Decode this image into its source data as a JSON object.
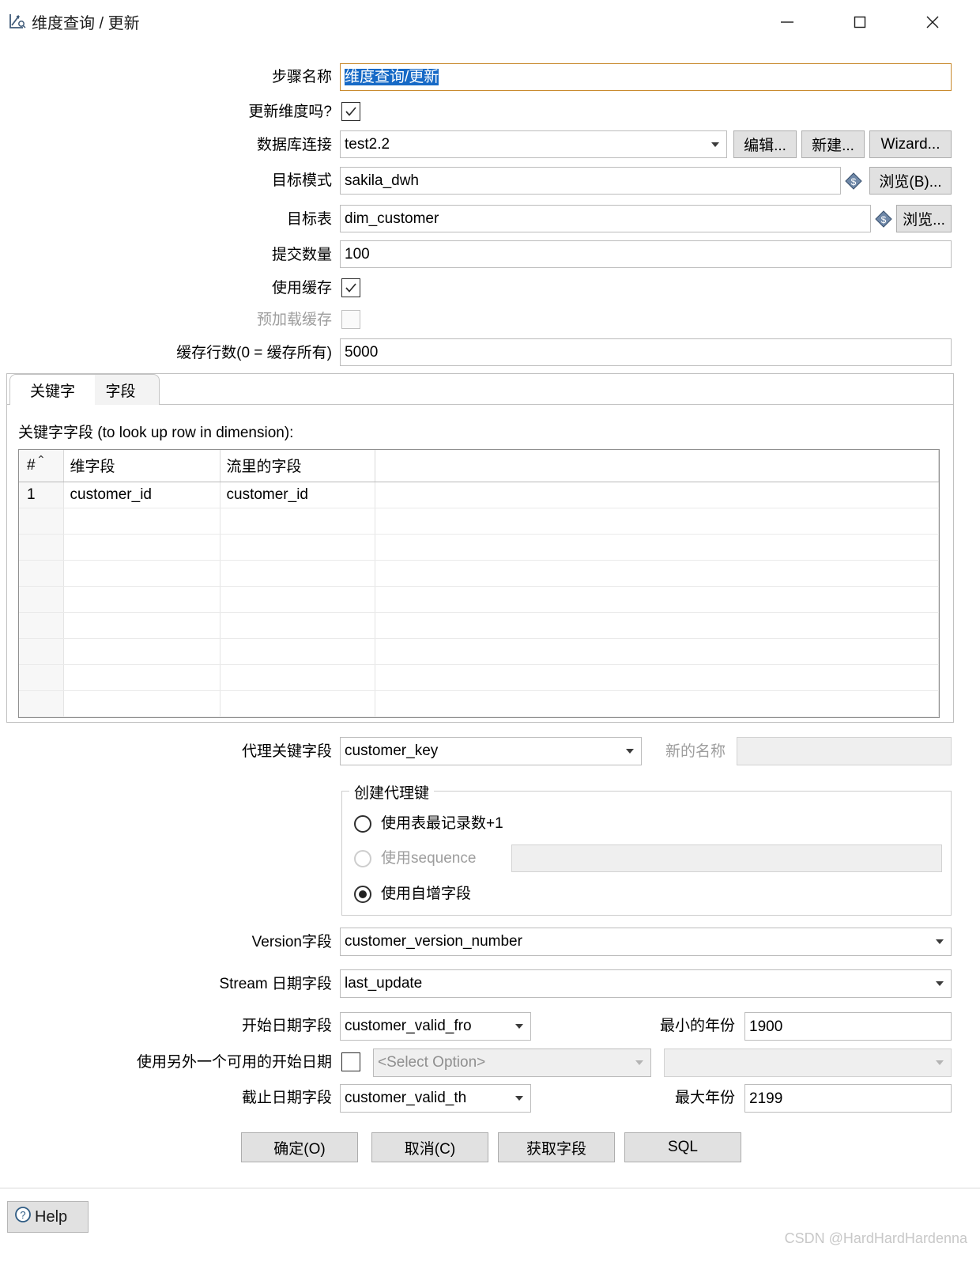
{
  "window": {
    "title": "维度查询 / 更新",
    "icon": "dimension-lookup-icon",
    "minimize_label": "—",
    "maximize_label": "□",
    "close_label": "✕"
  },
  "form": {
    "step_name": {
      "label": "步骤名称",
      "value": "维度查询/更新"
    },
    "update_dimension": {
      "label": "更新维度吗?",
      "checked": true
    },
    "connection": {
      "label": "数据库连接",
      "value": "test2.2"
    },
    "connection_buttons": {
      "edit": "编辑...",
      "new": "新建...",
      "wizard": "Wizard..."
    },
    "target_schema": {
      "label": "目标模式",
      "value": "sakila_dwh",
      "browse": "浏览(B)..."
    },
    "target_table": {
      "label": "目标表",
      "value": "dim_customer",
      "browse": "浏览..."
    },
    "commit_size": {
      "label": "提交数量",
      "value": "100"
    },
    "use_cache": {
      "label": "使用缓存",
      "checked": true
    },
    "preload_cache": {
      "label": "预加载缓存",
      "checked": false,
      "disabled": true
    },
    "cache_rows": {
      "label": "缓存行数(0 = 缓存所有)",
      "value": "5000"
    }
  },
  "tabs": {
    "items": [
      {
        "label": "关键字",
        "selected": true
      },
      {
        "label": "字段",
        "selected": false
      }
    ],
    "caption": "关键字字段 (to look up row in dimension):",
    "grid": {
      "columns": [
        "#",
        "维字段",
        "流里的字段",
        ""
      ],
      "sort_indicator": "⌃",
      "rows": [
        {
          "num": "1",
          "dim_field": "customer_id",
          "stream_field": "customer_id",
          "extra": ""
        }
      ],
      "empty_row_count": 9
    }
  },
  "surrogate": {
    "field_label": "代理关键字段",
    "field_value": "customer_key",
    "new_name_label": "新的名称",
    "new_name_value": "",
    "group_title": "创建代理键",
    "options": [
      {
        "label": "使用表最记录数+1",
        "selected": false,
        "disabled": false
      },
      {
        "label": "使用sequence",
        "selected": false,
        "disabled": true,
        "input_value": ""
      },
      {
        "label": "使用自增字段",
        "selected": true,
        "disabled": false
      }
    ]
  },
  "versioning": {
    "version_field": {
      "label": "Version字段",
      "value": "customer_version_number"
    },
    "stream_date_field": {
      "label": "Stream 日期字段",
      "value": "last_update"
    },
    "date_from_field": {
      "label": "开始日期字段",
      "value": "customer_valid_fro"
    },
    "min_year": {
      "label": "最小的年份",
      "value": "1900"
    },
    "alt_start_date": {
      "label": "使用另外一个可用的开始日期",
      "checked": false,
      "select_value": "<Select Option>",
      "second_select_value": ""
    },
    "date_to_field": {
      "label": "截止日期字段",
      "value": "customer_valid_th"
    },
    "max_year": {
      "label": "最大年份",
      "value": "2199"
    }
  },
  "buttons": {
    "ok": "确定(O)",
    "cancel": "取消(C)",
    "get_fields": "获取字段",
    "sql": "SQL",
    "help": "Help"
  },
  "watermark": "CSDN @HardHardHardenna",
  "colors": {
    "selection_blue": "#1669c6",
    "focus_border": "#c98a2e",
    "button_face": "#e1e1e1",
    "disabled_text": "#9d9d9d"
  }
}
